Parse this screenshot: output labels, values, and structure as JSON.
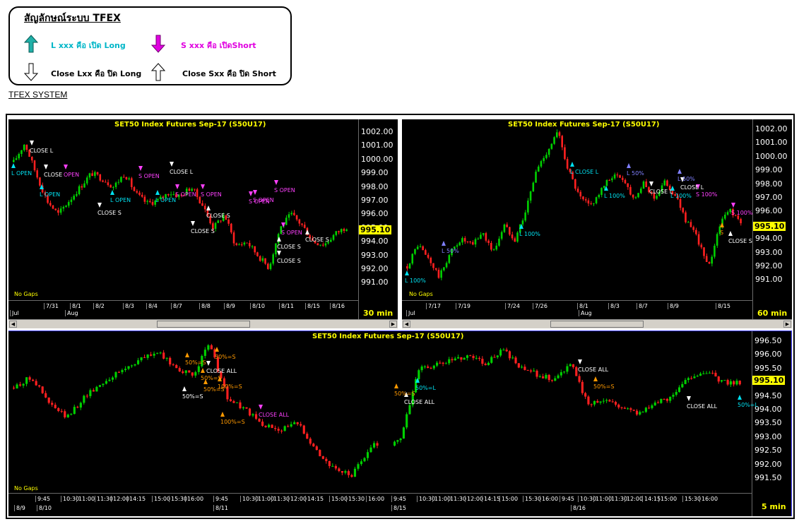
{
  "legend": {
    "title": "สัญลักษณ์ระบบ TFEX",
    "items": [
      {
        "label": "L xxx คือ เปิด Long",
        "color": "#00b6c8",
        "icon": "arrow-up-filled-icon"
      },
      {
        "label": "S xxx คือ เปิดShort",
        "color": "#e000e0",
        "icon": "arrow-down-filled-icon"
      },
      {
        "label": "Close Lxx คือ ปิด Long",
        "color": "#000000",
        "icon": "arrow-down-outline-icon"
      },
      {
        "label": "Close Sxx คือ ปิด Short",
        "color": "#000000",
        "icon": "arrow-up-outline-icon"
      }
    ]
  },
  "system_label": "TFEX SYSTEM",
  "colors": {
    "up": "#00d000",
    "down": "#ff2020",
    "long": "#00e0f0",
    "short": "#ff40ff",
    "close": "#ffffff",
    "partial": "#ff9900",
    "lpct": "#8080ff",
    "axis_text": "#ffffff",
    "title": "#ffff00"
  },
  "charts": [
    {
      "id": "30min",
      "title": "SET50  Index  Futures  Sep-17  (S50U17)",
      "timeframe": "30  min",
      "price_label": "995.10",
      "no_gaps": "No Gaps",
      "y_labels": [
        "1002.00",
        "1001.00",
        "1000.00",
        "999.00",
        "998.00",
        "997.00",
        "996.00",
        "995.00",
        "994.00",
        "993.00",
        "992.00",
        "991.00"
      ],
      "x_labels": [
        "7/31",
        "8/1",
        "8/2",
        "8/3",
        "8/4",
        "8/7",
        "8/8",
        "8/9",
        "8/10",
        "8/11",
        "8/15",
        "8/16"
      ],
      "x_labels2": [
        "Jul",
        "Aug"
      ],
      "signals": [
        "CLOSE  L",
        "L  OPEN",
        "CLOSE",
        "OPEN",
        "L  OPEN",
        "S  OPEN",
        "CLOSE  L",
        "L  OPEN",
        "L  OPEN",
        "S  OPEN",
        "S  OPEN",
        "S  OPEN",
        "CLOSE  S",
        "CLOSE  S",
        "CLOSE  S",
        "CLOSE  S",
        "S  OPEN",
        "S  OPEN",
        "S  OPEN",
        "CLOSE  S",
        "CLOSE  S"
      ]
    },
    {
      "id": "60min",
      "title": "SET50  Index  Futures  Sep-17  (S50U17)",
      "timeframe": "60  min",
      "price_label": "995.10",
      "no_gaps": "No Gaps",
      "y_labels": [
        "1002.00",
        "1001.00",
        "1000.00",
        "999.00",
        "998.00",
        "997.00",
        "996.00",
        "995.00",
        "994.00",
        "993.00",
        "992.00",
        "991.00"
      ],
      "x_labels": [
        "7/17",
        "7/19",
        "7/24",
        "7/26",
        "8/1",
        "8/3",
        "8/7",
        "8/9",
        "8/15"
      ],
      "x_labels2": [
        "Jul",
        "Aug"
      ],
      "signals": [
        "L  100%",
        "L  50%",
        "L  100%",
        "L  CLOSE  L",
        "L  50%",
        "L  100%",
        "CLOSE  L",
        "L  50%",
        "CLOSE  L",
        "L  100%",
        "S  100%",
        "S  100%",
        "S",
        "CLOSE  S"
      ]
    },
    {
      "id": "5min",
      "title": "SET50  Index  Futures  Sep-17  (S50U17)",
      "timeframe": "5  min",
      "price_label": "995.10",
      "no_gaps": "No Gaps",
      "y_labels": [
        "996.50",
        "996.00",
        "995.50",
        "995.00",
        "994.50",
        "994.00",
        "993.50",
        "993.00",
        "992.50",
        "992.00",
        "991.50"
      ],
      "x_labels": [
        "9:45",
        "10:30",
        "11:00",
        "11:30",
        "12:00",
        "14:15",
        "15:00",
        "15:30",
        "16:00",
        "9:45",
        "10:30",
        "11:00",
        "11:30",
        "12:00",
        "14:15",
        "15:00",
        "15:30",
        "16:00",
        "9:45",
        "10:30",
        "11:00",
        "11:30",
        "12:00",
        "14:15",
        "15:00",
        "15:30",
        "16:00",
        "9:45",
        "10:30",
        "11:00",
        "11:30",
        "12:00",
        "14:15",
        "15:00",
        "15:30",
        "16:00"
      ],
      "x_labels2": [
        "8/9",
        "8/10",
        "8/11",
        "8/15",
        "8/16"
      ],
      "signals": [
        "50%=S",
        "50%=S",
        "CLOSE  ALL",
        "50%=S",
        "100%=S",
        "50%=S",
        "CLOSE  ALL",
        "100%=S",
        "50%=S",
        "50%=S",
        "50%=L",
        "CLOSE  ALL",
        "CLOSE  ALL",
        "50%=S",
        "CLOSE  ALL",
        "50%=L"
      ]
    }
  ]
}
